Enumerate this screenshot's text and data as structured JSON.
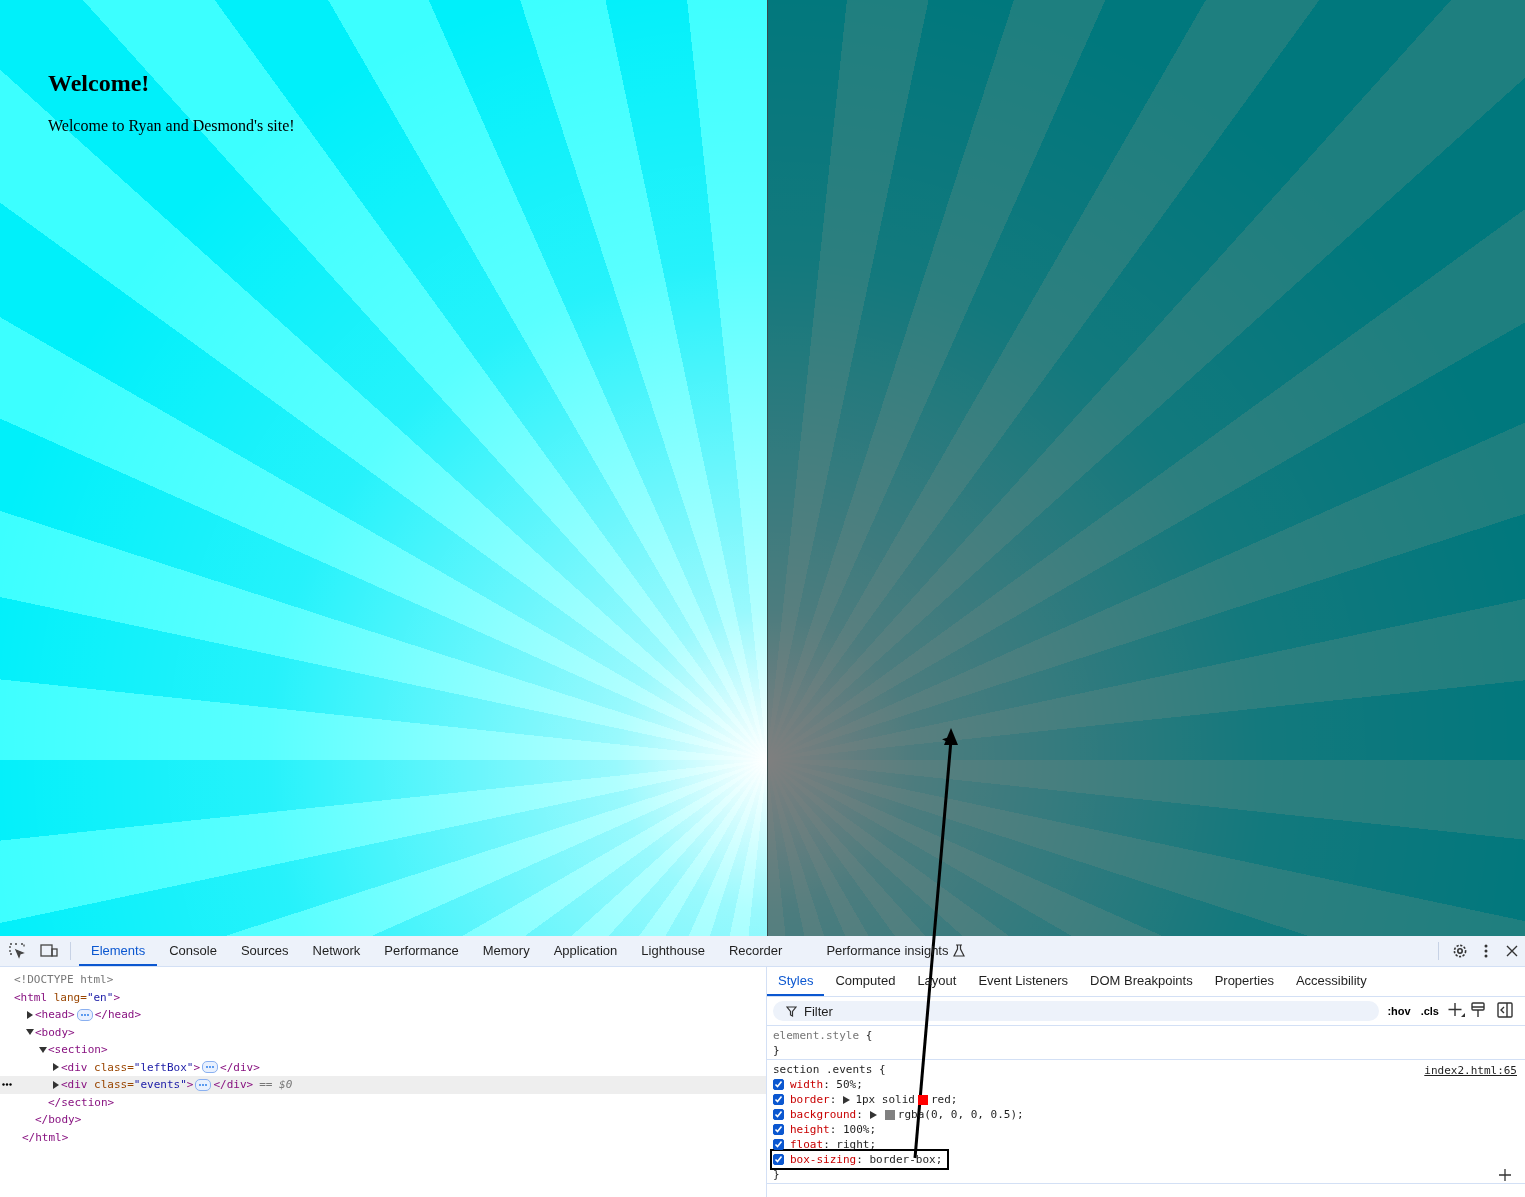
{
  "page": {
    "heading": "Welcome!",
    "text": "Welcome to Ryan and Desmond's site!"
  },
  "devtools": {
    "tabs": [
      {
        "label": "Elements",
        "selected": true
      },
      {
        "label": "Console",
        "selected": false
      },
      {
        "label": "Sources",
        "selected": false
      },
      {
        "label": "Network",
        "selected": false
      },
      {
        "label": "Performance",
        "selected": false
      },
      {
        "label": "Memory",
        "selected": false
      },
      {
        "label": "Application",
        "selected": false
      },
      {
        "label": "Lighthouse",
        "selected": false
      },
      {
        "label": "Recorder",
        "selected": false
      },
      {
        "label": "Performance insights",
        "selected": false,
        "kind": "experimental"
      }
    ],
    "elements": {
      "tree": [
        {
          "kind": "doctype",
          "selected": false,
          "parts": [
            {
              "text": "<!DOCTYPE html>"
            }
          ]
        },
        {
          "kind": "element",
          "selected": false,
          "parts": [
            {
              "kind": "tag",
              "text": "<html"
            },
            {
              "kind": "attr-name",
              "text": " lang="
            },
            {
              "kind": "attr-value",
              "text": "\"en\""
            },
            {
              "kind": "tag",
              "text": ">"
            }
          ],
          "close_line": "</html>",
          "children": [
            {
              "kind": "element",
              "selected": false,
              "expanded": false,
              "parts": [
                {
                  "kind": "tag",
                  "text": "<head>"
                }
              ],
              "collapsed_close": "</head>"
            },
            {
              "kind": "element",
              "selected": false,
              "expanded": true,
              "parts": [
                {
                  "kind": "tag",
                  "text": "<body>"
                }
              ],
              "close_line": "</body>",
              "children": [
                {
                  "kind": "element",
                  "selected": false,
                  "expanded": true,
                  "parts": [
                    {
                      "kind": "tag",
                      "text": "<section>"
                    }
                  ],
                  "close_line": "</section>",
                  "children": [
                    {
                      "kind": "element",
                      "selected": false,
                      "expanded": false,
                      "parts": [
                        {
                          "kind": "tag",
                          "text": "<div"
                        },
                        {
                          "kind": "attr-name",
                          "text": " class="
                        },
                        {
                          "kind": "attr-value",
                          "text": "\"leftBox\""
                        },
                        {
                          "kind": "tag",
                          "text": ">"
                        }
                      ],
                      "collapsed_close": "</div>"
                    },
                    {
                      "kind": "element",
                      "selected": true,
                      "expanded": false,
                      "parts": [
                        {
                          "kind": "tag",
                          "text": "<div"
                        },
                        {
                          "kind": "attr-name",
                          "text": " class="
                        },
                        {
                          "kind": "attr-value",
                          "text": "\"events\""
                        },
                        {
                          "kind": "tag",
                          "text": ">"
                        }
                      ],
                      "collapsed_close": "</div>",
                      "suffix": "== $0"
                    }
                  ]
                }
              ]
            }
          ]
        }
      ]
    },
    "sidebar_tabs": [
      {
        "label": "Styles",
        "selected": true
      },
      {
        "label": "Computed",
        "selected": false
      },
      {
        "label": "Layout",
        "selected": false
      },
      {
        "label": "Event Listeners",
        "selected": false
      },
      {
        "label": "DOM Breakpoints",
        "selected": false
      },
      {
        "label": "Properties",
        "selected": false
      },
      {
        "label": "Accessibility",
        "selected": false
      }
    ],
    "filter": {
      "placeholder": "Filter"
    },
    "toggles": [
      ":hov",
      ".cls"
    ],
    "rules": [
      {
        "selector": "element.style",
        "open_brace": " {",
        "close_brace": "}"
      },
      {
        "selector": "section .events",
        "open_brace": " {",
        "close_brace": "}",
        "source": "index2.html:65",
        "declarations": [
          {
            "name": "width",
            "checked": true,
            "highlighted": false,
            "value": [
              {
                "kind": "text",
                "text": ": 50%;"
              }
            ]
          },
          {
            "name": "border",
            "checked": true,
            "highlighted": false,
            "value": [
              {
                "kind": "text",
                "text": ":"
              },
              {
                "kind": "expander"
              },
              {
                "kind": "text",
                "text": "1px solid"
              },
              {
                "kind": "swatch",
                "color": "#ff0000"
              },
              {
                "kind": "text",
                "text": "red;"
              }
            ]
          },
          {
            "name": "background",
            "checked": true,
            "highlighted": false,
            "value": [
              {
                "kind": "text",
                "text": ":"
              },
              {
                "kind": "expander"
              },
              {
                "kind": "swatch",
                "color": "#808080"
              },
              {
                "kind": "text",
                "text": "rgba(0, 0, 0, 0.5);"
              }
            ]
          },
          {
            "name": "height",
            "checked": true,
            "highlighted": false,
            "value": [
              {
                "kind": "text",
                "text": ": 100%;"
              }
            ]
          },
          {
            "name": "float",
            "checked": true,
            "highlighted": false,
            "value": [
              {
                "kind": "text",
                "text": ": right;"
              }
            ]
          },
          {
            "name": "box-sizing",
            "checked": true,
            "highlighted": true,
            "value": [
              {
                "kind": "text",
                "text": ": border-box;"
              }
            ]
          }
        ]
      }
    ]
  }
}
